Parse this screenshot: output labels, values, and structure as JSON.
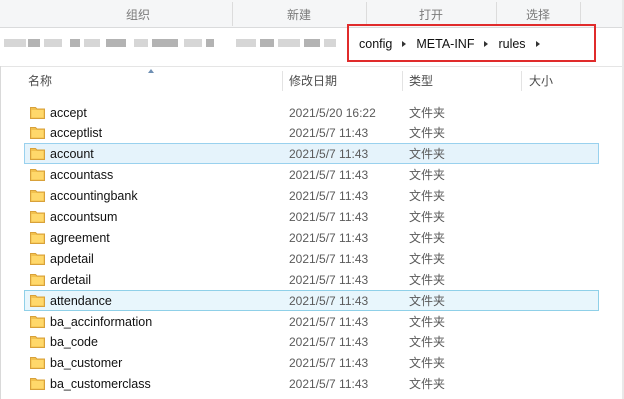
{
  "ribbon": {
    "groups": [
      "组织",
      "新建",
      "打开",
      "选择"
    ]
  },
  "address": {
    "breadcrumbs": [
      "config",
      "META-INF",
      "rules"
    ]
  },
  "columns": {
    "name": "名称",
    "modified": "修改日期",
    "type": "类型",
    "size": "大小"
  },
  "colors": {
    "folder": "#f2c14e",
    "highlight_border": "#e02b2b",
    "selected_bg": "#e5f3fb"
  },
  "files": [
    {
      "name": "accept",
      "date": "2021/5/20 16:22",
      "type": "文件夹",
      "state": "normal"
    },
    {
      "name": "acceptlist",
      "date": "2021/5/7 11:43",
      "type": "文件夹",
      "state": "normal"
    },
    {
      "name": "account",
      "date": "2021/5/7 11:43",
      "type": "文件夹",
      "state": "selected"
    },
    {
      "name": "accountass",
      "date": "2021/5/7 11:43",
      "type": "文件夹",
      "state": "normal"
    },
    {
      "name": "accountingbank",
      "date": "2021/5/7 11:43",
      "type": "文件夹",
      "state": "normal"
    },
    {
      "name": "accountsum",
      "date": "2021/5/7 11:43",
      "type": "文件夹",
      "state": "normal"
    },
    {
      "name": "agreement",
      "date": "2021/5/7 11:43",
      "type": "文件夹",
      "state": "normal"
    },
    {
      "name": "apdetail",
      "date": "2021/5/7 11:43",
      "type": "文件夹",
      "state": "normal"
    },
    {
      "name": "ardetail",
      "date": "2021/5/7 11:43",
      "type": "文件夹",
      "state": "normal"
    },
    {
      "name": "attendance",
      "date": "2021/5/7 11:43",
      "type": "文件夹",
      "state": "hover"
    },
    {
      "name": "ba_accinformation",
      "date": "2021/5/7 11:43",
      "type": "文件夹",
      "state": "normal"
    },
    {
      "name": "ba_code",
      "date": "2021/5/7 11:43",
      "type": "文件夹",
      "state": "normal"
    },
    {
      "name": "ba_customer",
      "date": "2021/5/7 11:43",
      "type": "文件夹",
      "state": "normal"
    },
    {
      "name": "ba_customerclass",
      "date": "2021/5/7 11:43",
      "type": "文件夹",
      "state": "normal"
    }
  ]
}
